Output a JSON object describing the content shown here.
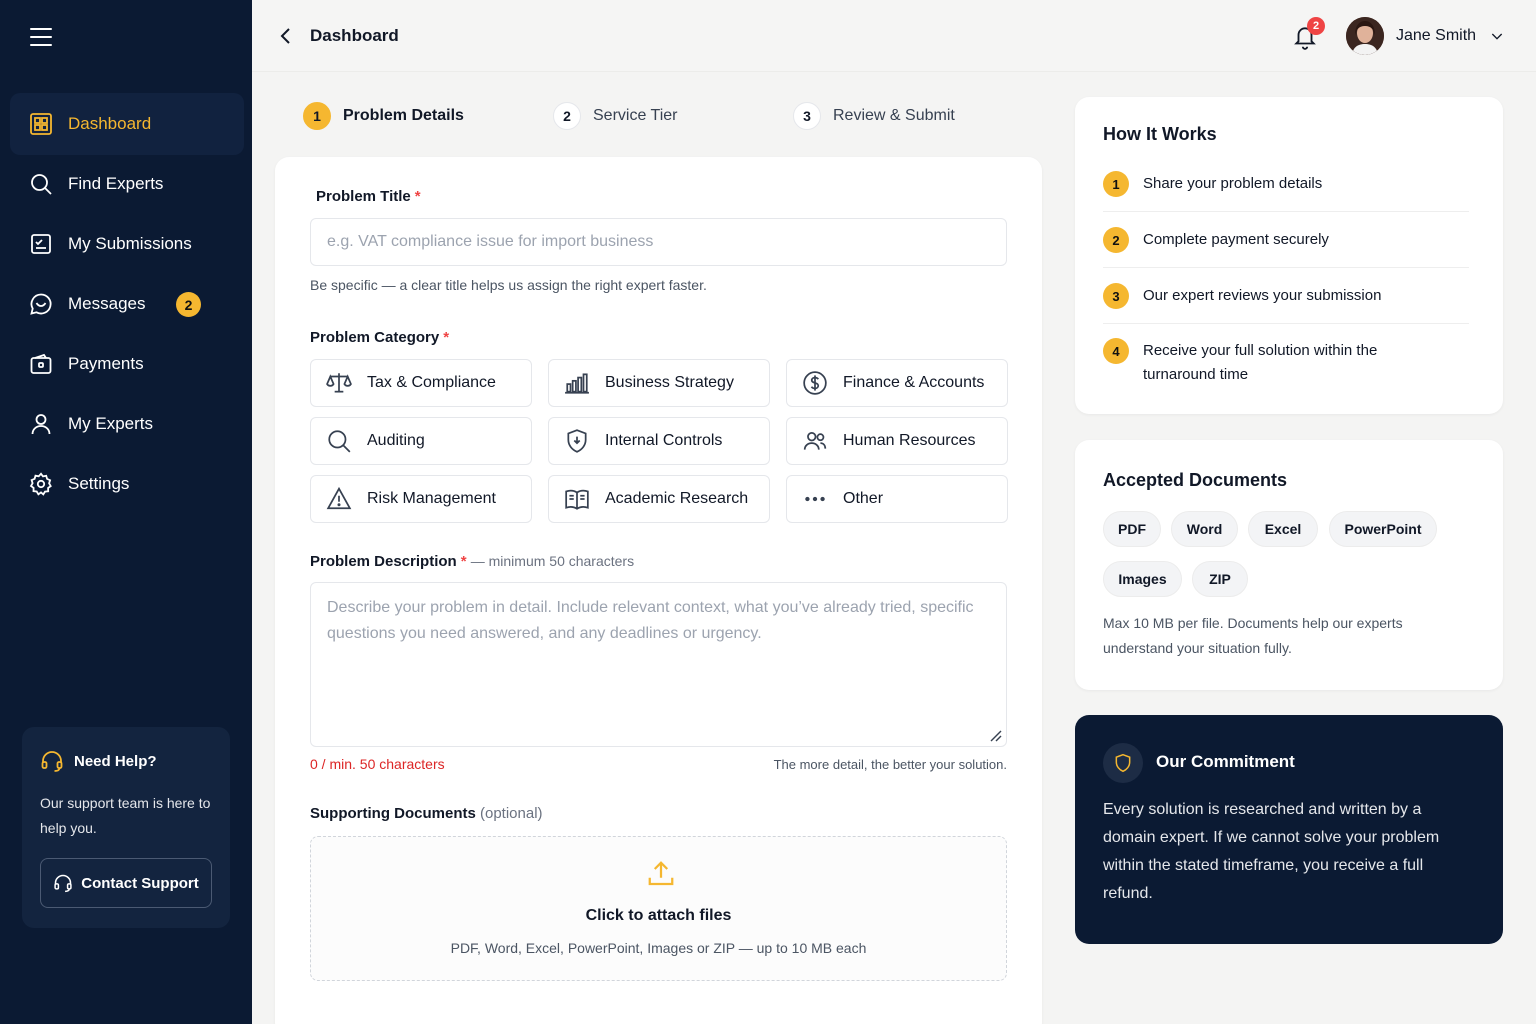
{
  "sidebar": {
    "items": [
      {
        "label": "Dashboard",
        "icon": "dashboard-icon"
      },
      {
        "label": "Find Experts",
        "icon": "search-icon"
      },
      {
        "label": "My Submissions",
        "icon": "submissions-icon"
      },
      {
        "label": "Messages",
        "icon": "message-icon",
        "badge": "2"
      },
      {
        "label": "Payments",
        "icon": "wallet-icon"
      },
      {
        "label": "My Experts",
        "icon": "user-icon"
      },
      {
        "label": "Settings",
        "icon": "gear-icon"
      }
    ],
    "help": {
      "title": "Need Help?",
      "text": "Our support team is here to help you.",
      "button": "Contact Support"
    }
  },
  "topbar": {
    "title": "Dashboard",
    "notification_count": "2",
    "user_name": "Jane Smith"
  },
  "steps": [
    {
      "num": "1",
      "label": "Problem Details",
      "active": true
    },
    {
      "num": "2",
      "label": "Service Tier",
      "active": false
    },
    {
      "num": "3",
      "label": "Review & Submit",
      "active": false
    }
  ],
  "form": {
    "title_label": "Problem Title",
    "required_mark": "*",
    "title_placeholder": "e.g. VAT compliance issue for import business",
    "title_value": "",
    "title_hint": "Be specific — a clear title helps us assign the right expert faster.",
    "category_label": "Problem Category",
    "categories": [
      {
        "label": "Tax & Compliance",
        "icon": "scale-icon"
      },
      {
        "label": "Business Strategy",
        "icon": "bar-chart-icon"
      },
      {
        "label": "Finance & Accounts",
        "icon": "dollar-icon"
      },
      {
        "label": "Auditing",
        "icon": "search-icon"
      },
      {
        "label": "Internal Controls",
        "icon": "shield-icon"
      },
      {
        "label": "Human Resources",
        "icon": "users-icon"
      },
      {
        "label": "Risk Management",
        "icon": "warning-icon"
      },
      {
        "label": "Academic Research",
        "icon": "book-icon"
      },
      {
        "label": "Other",
        "icon": "more-icon"
      }
    ],
    "description_label": "Problem Description",
    "description_suffix": "— minimum 50 characters",
    "description_placeholder": "Describe your problem in detail. Include relevant context, what you’ve already tried, specific questions you need answered, and any deadlines or urgency.",
    "description_value": "",
    "char_count": "0 / min. 50 characters",
    "description_hint": "The more detail, the better your solution.",
    "docs_label": "Supporting Documents",
    "docs_optional": "(optional)",
    "dropzone_title": "Click to attach files",
    "dropzone_sub": "PDF, Word, Excel, PowerPoint, Images or ZIP — up to 10 MB each"
  },
  "how_it_works": {
    "title": "How It Works",
    "steps": [
      {
        "num": "1",
        "text": "Share your problem details"
      },
      {
        "num": "2",
        "text": "Complete payment securely"
      },
      {
        "num": "3",
        "text": "Our expert reviews your submission"
      },
      {
        "num": "4",
        "text": "Receive your full solution within the turnaround time"
      }
    ]
  },
  "accepted_documents": {
    "title": "Accepted Documents",
    "types": [
      "PDF",
      "Word",
      "Excel",
      "PowerPoint",
      "Images",
      "ZIP"
    ],
    "note": "Max 10 MB per file. Documents help our experts understand your situation fully."
  },
  "commitment": {
    "title": "Our Commitment",
    "text": "Every solution is researched and written by a domain expert. If we cannot solve your problem within the stated timeframe, you receive a full refund."
  },
  "colors": {
    "accent": "#f5b730",
    "sidebar_bg": "#0b1a33",
    "required": "#ef4444"
  }
}
